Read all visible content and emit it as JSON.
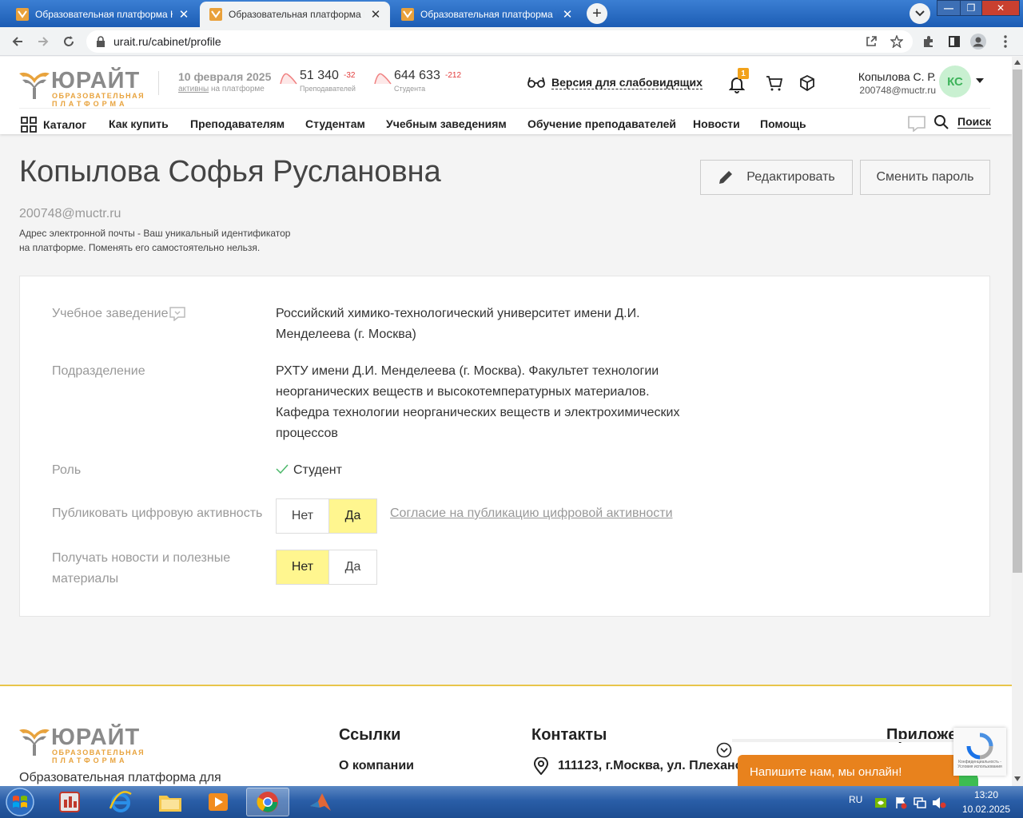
{
  "browser": {
    "tabs": [
      {
        "title": "Образовательная платформа Ю",
        "active": false
      },
      {
        "title": "Образовательная платформа Ю",
        "active": true
      },
      {
        "title": "Образовательная платформа Ю",
        "active": false
      }
    ],
    "close_glyph": "✕",
    "new_tab_glyph": "+",
    "url": "urait.ru/cabinet/profile",
    "win_min": "—",
    "win_max": "❐",
    "win_close": "✕"
  },
  "header": {
    "logo_word": "ЮРАЙТ",
    "logo_sub1": "ОБРАЗОВАТЕЛЬНАЯ",
    "logo_sub2": "ПЛАТФОРМА",
    "date": "10 февраля 2025",
    "active_link": "активны",
    "active_rest": "на платформе",
    "teachers": {
      "value": "51 340",
      "delta": "-32",
      "label": "Преподавателей"
    },
    "students": {
      "value": "644 633",
      "delta": "-212",
      "label": "Студента"
    },
    "accessibility": "Версия для слабовидящих",
    "notifications_count": "1",
    "user_name": "Копылова С. Р.",
    "user_email": "200748@muctr.ru",
    "avatar_initials": "КС",
    "brand_color": "#e8a33d"
  },
  "menu": {
    "catalog": "Каталог",
    "items": [
      "Как купить",
      "Преподавателям",
      "Студентам",
      "Учебным заведениям",
      "Обучение преподавателей",
      "Новости",
      "Помощь"
    ],
    "search": "Поиск"
  },
  "profile": {
    "full_name": "Копылова Софья Руслановна",
    "edit_button": "Редактировать",
    "change_password": "Сменить пароль",
    "email": "200748@muctr.ru",
    "email_note_1": "Адрес электронной почты - Ваш уникальный идентификатор",
    "email_note_2": "на платформе. Поменять его самостоятельно нельзя.",
    "fields": {
      "institution_label": "Учебное заведение",
      "institution_value_1": "Российский химико-технологический университет имени Д.И.",
      "institution_value_2": "Менделеева (г. Москва)",
      "division_label": "Подразделение",
      "division_value_1": "РХТУ имени Д.И. Менделеева (г. Москва). Факультет технологии",
      "division_value_2": "неорганических веществ и высокотемпературных материалов.",
      "division_value_3": "Кафедра технологии неорганических веществ и электрохимических",
      "division_value_4": "процессов",
      "role_label": "Роль",
      "role_value": "Студент",
      "publish_label": "Публиковать цифровую активность",
      "publish_no": "Нет",
      "publish_yes": "Да",
      "publish_selected": "Да",
      "publish_consent": "Согласие на публикацию цифровой активности",
      "news_label_1": "Получать новости и полезные",
      "news_label_2": "материалы",
      "news_no": "Нет",
      "news_yes": "Да",
      "news_selected": "Нет"
    }
  },
  "footer": {
    "tagline": "Образовательная платформа для",
    "links_title": "Ссылки",
    "links_first": "О компании",
    "contacts_title": "Контакты",
    "address": "111123, г.Москва, ул. Плехано",
    "apps_title": "Приложе",
    "chat": "Напишите нам, мы онлайн!",
    "recaptcha_text": "Конфиденциальность - Условия использования"
  },
  "taskbar": {
    "lang": "RU",
    "time": "13:20",
    "date": "10.02.2025"
  }
}
